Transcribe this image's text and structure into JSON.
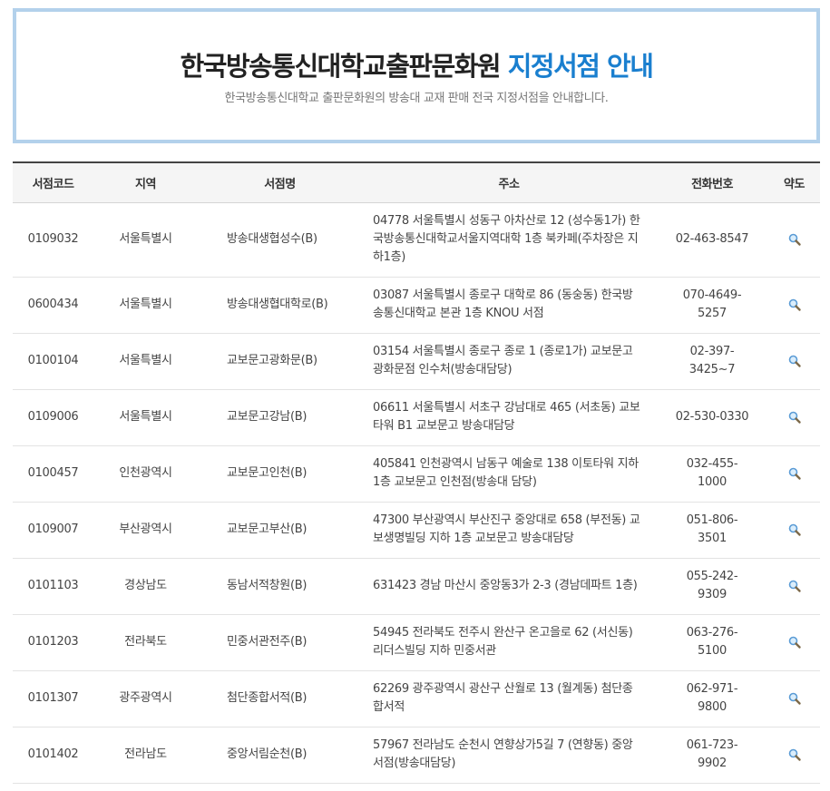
{
  "banner": {
    "title_main": "한국방송통신대학교출판문화원",
    "title_highlight": "지정서점 안내",
    "subtitle": "한국방송통신대학교 출판문화원의 방송대 교재 판매 전국 지정서점을 안내합니다."
  },
  "colors": {
    "accent": "#1a7fcf",
    "banner_border": "#b3d1eb"
  },
  "table": {
    "headers": [
      "서점코드",
      "지역",
      "서점명",
      "주소",
      "전화번호",
      "약도"
    ],
    "map_icon": "magnifier-icon",
    "rows": [
      {
        "code": "0109032",
        "region": "서울특별시",
        "name": "방송대생협성수(B)",
        "address": "04778 서울특별시 성동구 아차산로 12 (성수동1가) 한국방송통신대학교서울지역대학 1층 북카페(주차장은 지하1층)",
        "phone": "02-463-8547"
      },
      {
        "code": "0600434",
        "region": "서울특별시",
        "name": "방송대생협대학로(B)",
        "address": "03087 서울특별시 종로구 대학로 86 (동숭동) 한국방송통신대학교 본관 1층 KNOU 서점",
        "phone": "070-4649-5257"
      },
      {
        "code": "0100104",
        "region": "서울특별시",
        "name": "교보문고광화문(B)",
        "address": "03154 서울특별시 종로구 종로 1 (종로1가) 교보문고 광화문점 인수처(방송대담당)",
        "phone": "02-397-3425~7"
      },
      {
        "code": "0109006",
        "region": "서울특별시",
        "name": "교보문고강남(B)",
        "address": "06611 서울특별시 서초구 강남대로 465 (서초동) 교보타워 B1 교보문고 방송대담당",
        "phone": "02-530-0330"
      },
      {
        "code": "0100457",
        "region": "인천광역시",
        "name": "교보문고인천(B)",
        "address": "405841 인천광역시 남동구 예술로 138 이토타워 지하1층 교보문고 인천점(방송대 담당)",
        "phone": "032-455-1000"
      },
      {
        "code": "0109007",
        "region": "부산광역시",
        "name": "교보문고부산(B)",
        "address": "47300 부산광역시 부산진구 중앙대로 658 (부전동) 교보생명빌딩 지하 1층 교보문고 방송대담당",
        "phone": "051-806-3501"
      },
      {
        "code": "0101103",
        "region": "경상남도",
        "name": "동남서적창원(B)",
        "address": "631423 경남 마산시 중앙동3가 2-3 (경남데파트 1층)",
        "phone": "055-242-9309"
      },
      {
        "code": "0101203",
        "region": "전라북도",
        "name": "민중서관전주(B)",
        "address": "54945 전라북도 전주시 완산구 온고을로 62 (서신동) 리더스빌딩 지하 민중서관",
        "phone": "063-276-5100"
      },
      {
        "code": "0101307",
        "region": "광주광역시",
        "name": "첨단종합서적(B)",
        "address": "62269 광주광역시 광산구 산월로 13 (월계동) 첨단종합서적",
        "phone": "062-971-9800"
      },
      {
        "code": "0101402",
        "region": "전라남도",
        "name": "중앙서림순천(B)",
        "address": "57967 전라남도 순천시 연향상가5길 7 (연향동) 중앙서점(방송대담당)",
        "phone": "061-723-9902"
      }
    ]
  }
}
